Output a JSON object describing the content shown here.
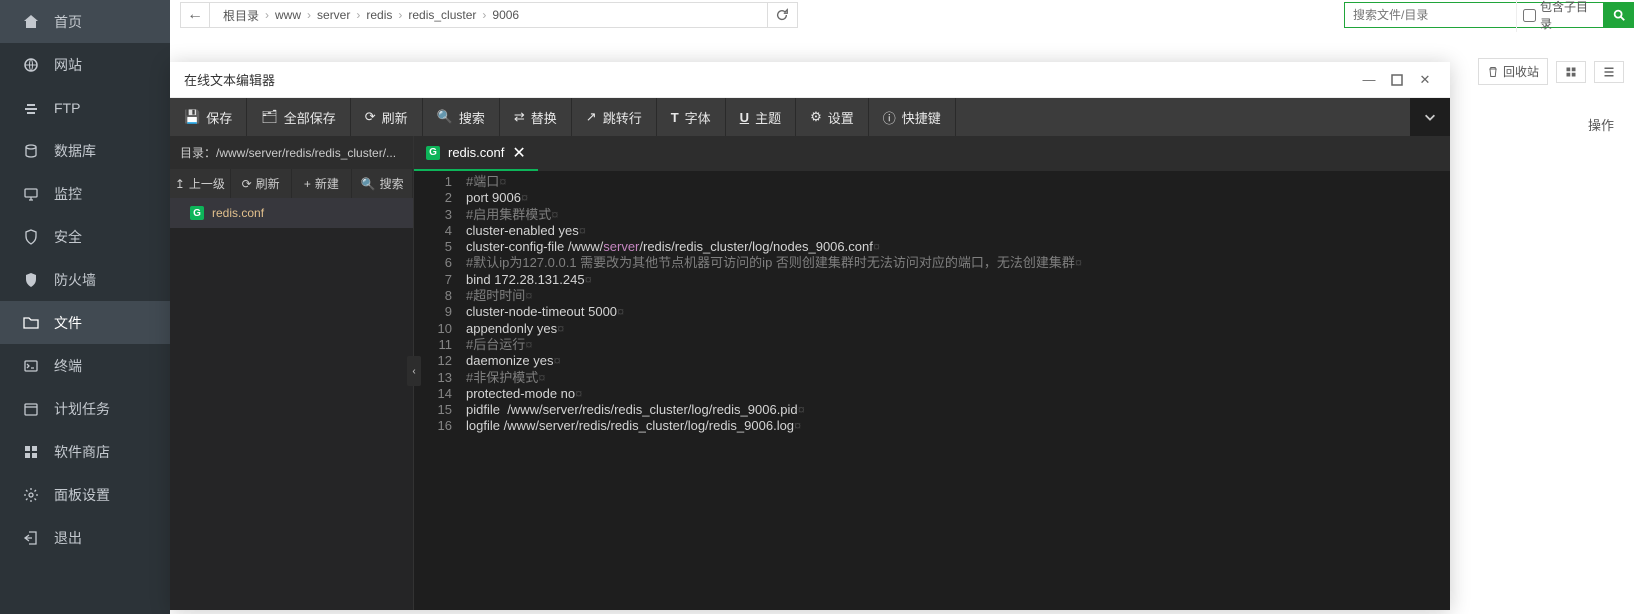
{
  "sidebar": {
    "items": [
      {
        "label": "首页"
      },
      {
        "label": "网站"
      },
      {
        "label": "FTP"
      },
      {
        "label": "数据库"
      },
      {
        "label": "监控"
      },
      {
        "label": "安全"
      },
      {
        "label": "防火墙"
      },
      {
        "label": "文件"
      },
      {
        "label": "终端"
      },
      {
        "label": "计划任务"
      },
      {
        "label": "软件商店"
      },
      {
        "label": "面板设置"
      },
      {
        "label": "退出"
      }
    ]
  },
  "breadcrumb": [
    "根目录",
    "www",
    "server",
    "redis",
    "redis_cluster",
    "9006"
  ],
  "search": {
    "placeholder": "搜索文件/目录",
    "include_sub": "包含子目录"
  },
  "right_actions": {
    "recycle": "回收站",
    "ops": "操作"
  },
  "editor": {
    "title": "在线文本编辑器",
    "toolbar": [
      "保存",
      "全部保存",
      "刷新",
      "搜索",
      "替换",
      "跳转行",
      "字体",
      "主题",
      "设置",
      "快捷键"
    ],
    "file_panel": {
      "path_label": "目录：/www/server/redis/redis_cluster/...",
      "tools": [
        "上一级",
        "刷新",
        "新建",
        "搜索"
      ],
      "file": "redis.conf"
    },
    "tab": {
      "name": "redis.conf"
    },
    "code": {
      "lines": [
        {
          "n": 1,
          "text": "#端口"
        },
        {
          "n": 2,
          "text": "port 9006"
        },
        {
          "n": 3,
          "text": "#启用集群模式"
        },
        {
          "n": 4,
          "text": "cluster-enabled yes"
        },
        {
          "n": 5,
          "text": "cluster-config-file /www/server/redis/redis_cluster/log/nodes_9006.conf"
        },
        {
          "n": 6,
          "text": "#默认ip为127.0.0.1 需要改为其他节点机器可访问的ip 否则创建集群时无法访问对应的端口，无法创建集群"
        },
        {
          "n": 7,
          "text": "bind 172.28.131.245"
        },
        {
          "n": 8,
          "text": "#超时时间"
        },
        {
          "n": 9,
          "text": "cluster-node-timeout 5000"
        },
        {
          "n": 10,
          "text": "appendonly yes"
        },
        {
          "n": 11,
          "text": "#后台运行"
        },
        {
          "n": 12,
          "text": "daemonize yes"
        },
        {
          "n": 13,
          "text": "#非保护模式"
        },
        {
          "n": 14,
          "text": "protected-mode no"
        },
        {
          "n": 15,
          "text": "pidfile  /www/server/redis/redis_cluster/log/redis_9006.pid"
        },
        {
          "n": 16,
          "text": "logfile /www/server/redis/redis_cluster/log/redis_9006.log"
        }
      ]
    }
  }
}
